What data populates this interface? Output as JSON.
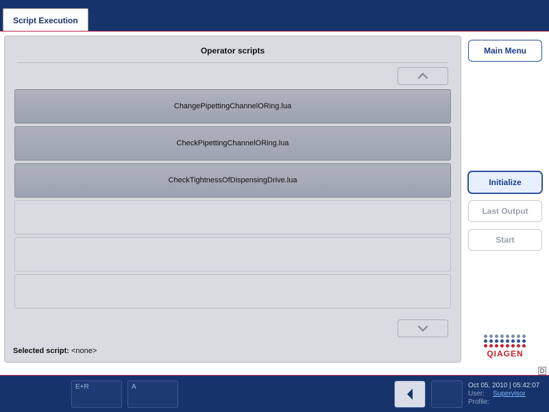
{
  "tab": {
    "label": "Script Execution"
  },
  "panel": {
    "title": "Operator scripts",
    "scripts": [
      "ChangePipettingChannelORing.lua",
      "CheckPipettingChannelORing.lua",
      "CheckTightnessOfDispensingDrive.lua"
    ],
    "selected_label": "Selected script:",
    "selected_value": "<none>"
  },
  "side": {
    "main_menu": "Main Menu",
    "initialize": "Initialize",
    "last_output": "Last Output",
    "start": "Start",
    "logo_text": "QIAGEN"
  },
  "badge": {
    "d": "D"
  },
  "status": {
    "box1": "E+R",
    "box2": "A",
    "datetime": "Oct 05, 2010 | 05:42:07",
    "user_label": "User:",
    "user_value": "Supervisor",
    "profile_label": "Profile:",
    "profile_value": ""
  },
  "logo_colors": {
    "row1": [
      "#7c8aa5",
      "#7c8aa5",
      "#7c8aa5",
      "#7c8aa5",
      "#7c8aa5",
      "#7c8aa5",
      "#7c8aa5",
      "#7c8aa5"
    ],
    "row2": [
      "#2a4f9a",
      "#2a4f9a",
      "#2a4f9a",
      "#2a4f9a",
      "#2a4f9a",
      "#2a4f9a",
      "#2a4f9a",
      "#2a4f9a"
    ],
    "row3": [
      "#c62131",
      "#c62131",
      "#c62131",
      "#c62131",
      "#c62131",
      "#c62131",
      "#c62131",
      "#c62131"
    ]
  }
}
